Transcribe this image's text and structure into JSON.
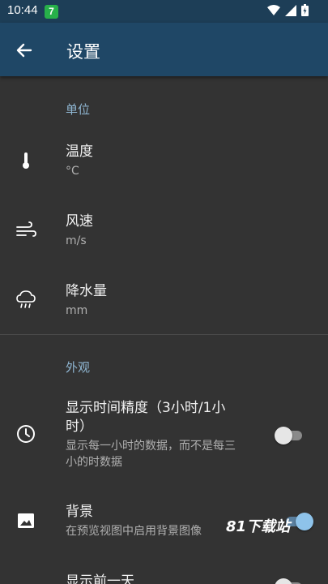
{
  "status_bar": {
    "time": "10:44",
    "app_badge": "7"
  },
  "app_bar": {
    "title": "设置"
  },
  "sections": {
    "units": {
      "header": "单位",
      "temperature": {
        "title": "温度",
        "value": "°C"
      },
      "wind_speed": {
        "title": "风速",
        "value": "m/s"
      },
      "precipitation": {
        "title": "降水量",
        "value": "mm"
      }
    },
    "appearance": {
      "header": "外观",
      "hourly_precision": {
        "title_line1": "显示时间精度（3小时/1小",
        "title_line2": "时）",
        "sub_line1": "显示每一小时的数据，而不是每三",
        "sub_line2": "小的时数据",
        "enabled": false
      },
      "background": {
        "title": "背景",
        "sub": "在预览视图中启用背景图像",
        "enabled": true
      },
      "previous_day": {
        "title": "显示前一天"
      }
    }
  },
  "watermark": "81下载站",
  "colors": {
    "toolbar": "#1f4766",
    "status_bar": "#1d3e57",
    "accent": "#8fb6d2",
    "background": "#333333"
  }
}
